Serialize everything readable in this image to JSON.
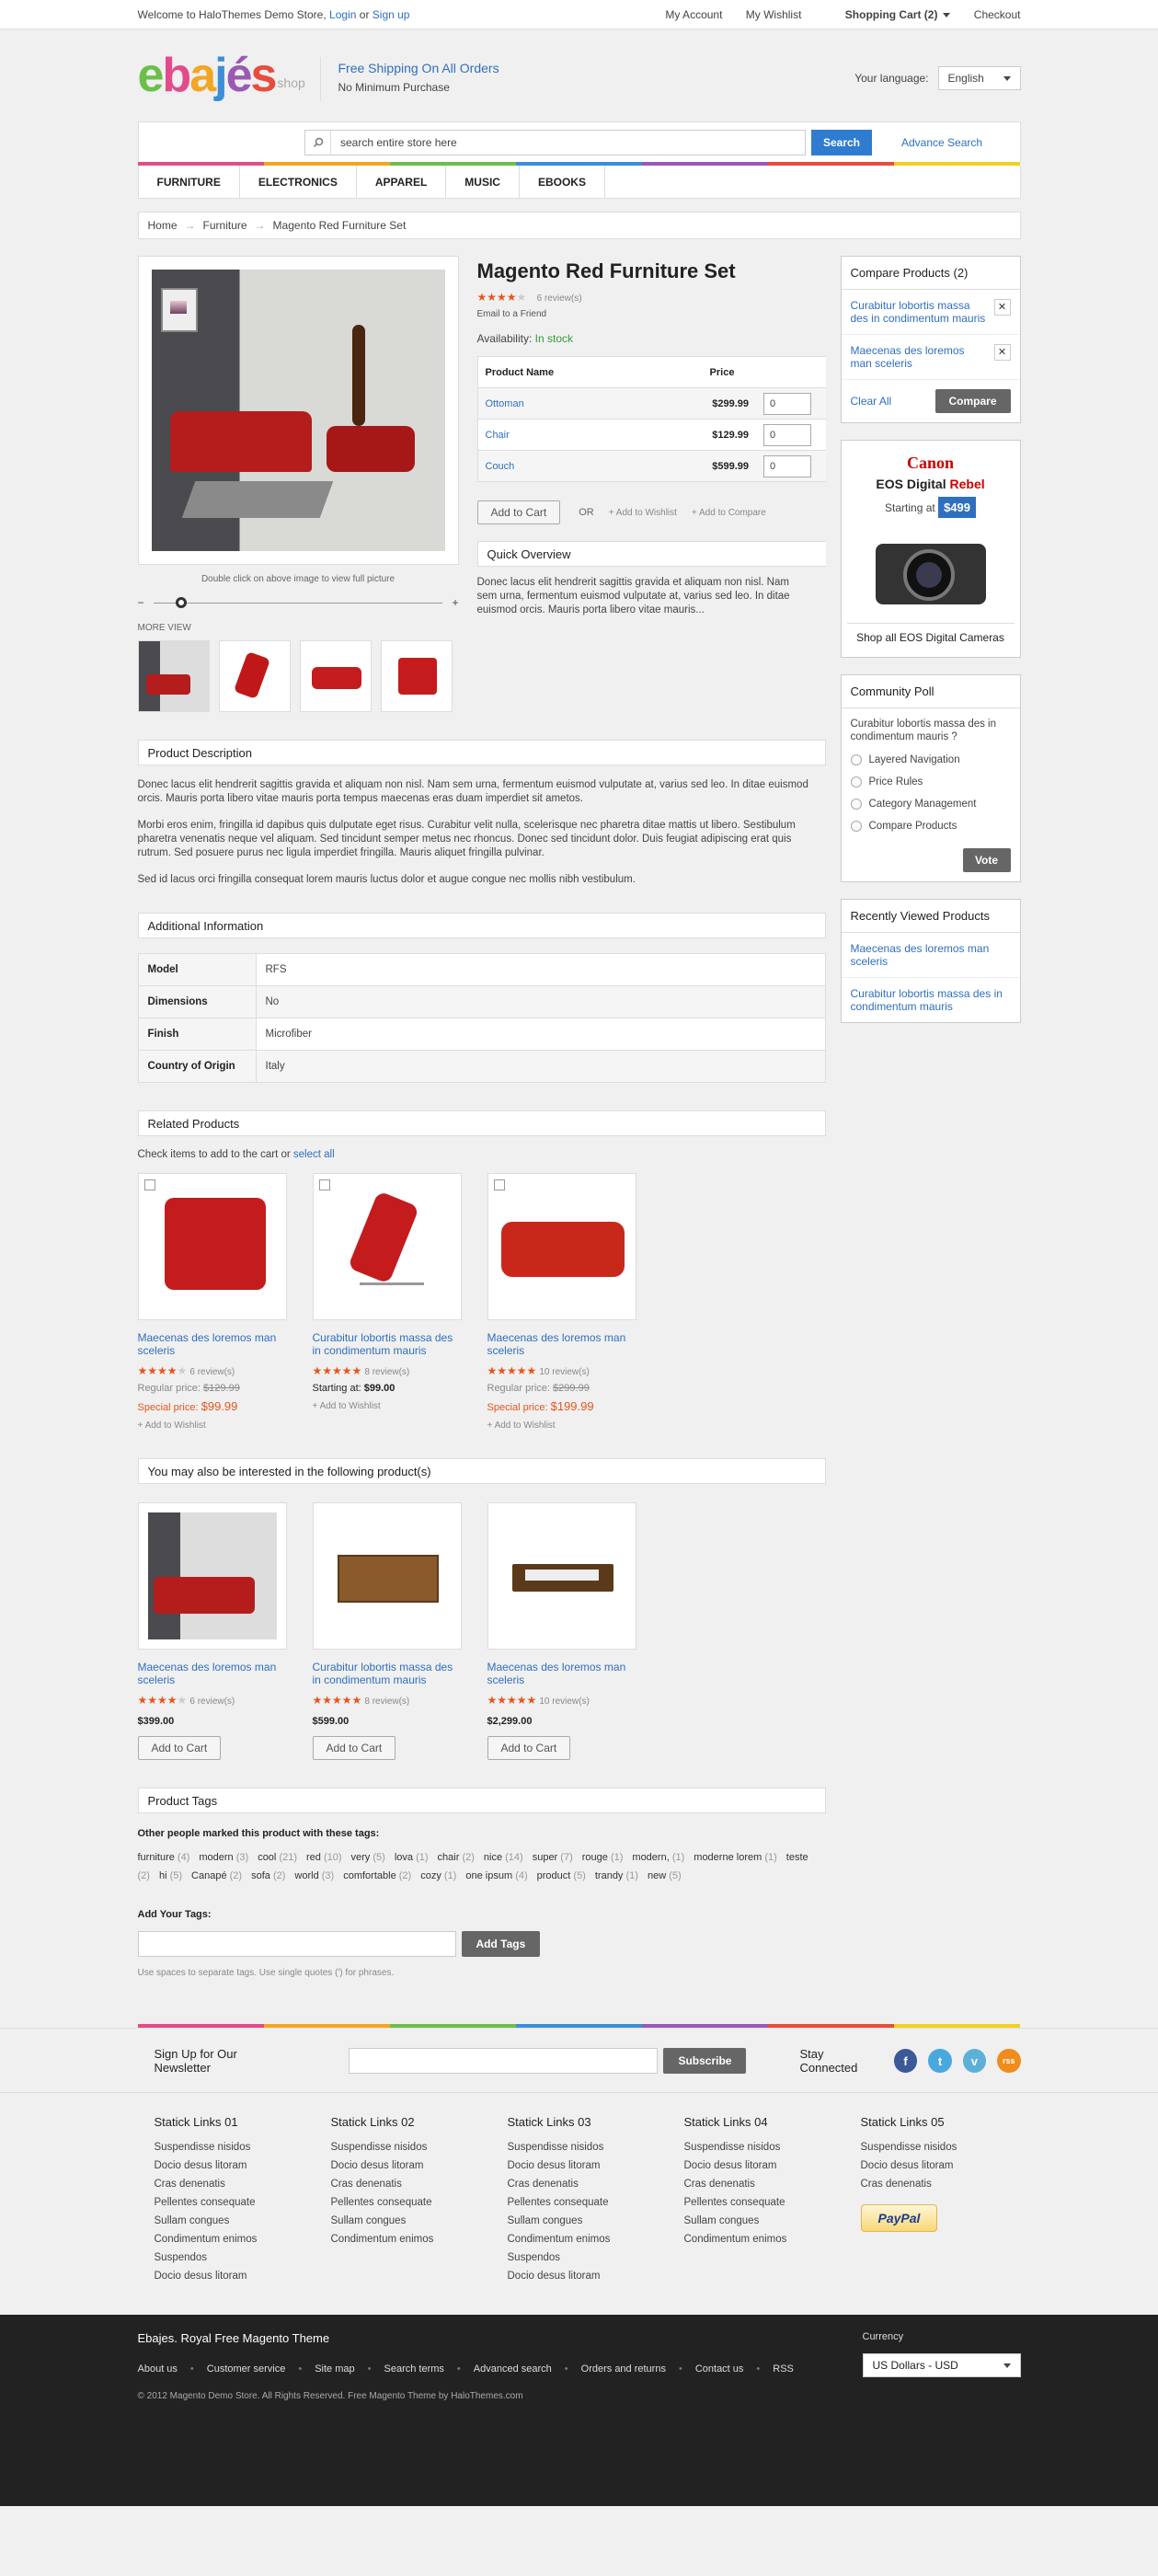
{
  "topbar": {
    "welcome": "Welcome to HaloThemes Demo Store,",
    "login": "Login",
    "or": "or",
    "signup": "Sign up",
    "links": [
      "My Account",
      "My Wishlist",
      "Shopping Cart (2)",
      "Checkout"
    ]
  },
  "header": {
    "logo": [
      "e",
      "b",
      "a",
      "j",
      "é",
      "s"
    ],
    "logo_sub": "shop",
    "shipping_title": "Free Shipping On All Orders",
    "shipping_sub": "No Minimum Purchase",
    "lang_label": "Your language:",
    "lang_value": "English"
  },
  "search": {
    "placeholder": "search entire store here",
    "button": "Search",
    "advanced": "Advance Search"
  },
  "nav": [
    "FURNITURE",
    "ELECTRONICS",
    "APPAREL",
    "MUSIC",
    "EBOOKS"
  ],
  "rainbow_colors": [
    "#e34c8a",
    "#f2a623",
    "#6cbf4a",
    "#3a8fd8",
    "#9b59b6",
    "#e84c3d",
    "#f2d023"
  ],
  "breadcrumb": [
    "Home",
    "Furniture",
    "Magento Red Furniture Set"
  ],
  "product": {
    "name": "Magento Red Furniture Set",
    "reviews": "6 review(s)",
    "email_friend": "Email to a Friend",
    "availability_label": "Availability:",
    "availability": "In stock",
    "image_hint": "Double click on above image to view full picture",
    "more_views": "MORE VIEW",
    "grouped_headers": [
      "Product Name",
      "Price"
    ],
    "grouped": [
      {
        "name": "Ottoman",
        "price": "$299.99",
        "qty": "0"
      },
      {
        "name": "Chair",
        "price": "$129.99",
        "qty": "0"
      },
      {
        "name": "Couch",
        "price": "$599.99",
        "qty": "0"
      }
    ],
    "add_to_cart": "Add to Cart",
    "or": "OR",
    "add_wishlist": "Add to Wishlist",
    "add_compare": "Add to Compare",
    "quick_overview_title": "Quick Overview",
    "quick_overview": "Donec lacus elit hendrerit sagittis gravida et aliquam non nisl. Nam sem urna, fermentum euismod vulputate at, varius sed leo. In ditae euismod orcis. Mauris porta libero vitae mauris..."
  },
  "description": {
    "title": "Product Description",
    "paragraphs": [
      "Donec lacus elit hendrerit sagittis gravida et aliquam non nisl. Nam sem urna, fermentum euismod vulputate at, varius sed leo. In ditae euismod orcis. Mauris porta libero vitae mauris porta tempus maecenas eras duam imperdiet sit ametos.",
      "Morbi eros enim, fringilla id dapibus quis dulputate eget risus. Curabitur velit nulla, scelerisque nec pharetra ditae mattis ut libero. Sestibulum pharetra venenatis neque vel aliquam. Sed tincidunt semper metus nec rhoncus. Donec sed tincidunt dolor. Duis feugiat adipiscing erat quis rutrum. Sed posuere purus nec ligula imperdiet fringilla. Mauris aliquet fringilla pulvinar.",
      "Sed id lacus orci fringilla consequat lorem mauris luctus dolor et augue congue nec mollis nibh vestibulum."
    ]
  },
  "additional": {
    "title": "Additional Information",
    "rows": [
      [
        "Model",
        "RFS"
      ],
      [
        "Dimensions",
        "No"
      ],
      [
        "Finish",
        "Microfiber"
      ],
      [
        "Country of Origin",
        "Italy"
      ]
    ]
  },
  "related": {
    "title": "Related Products",
    "intro": "Check items to add to the cart or",
    "select_all": "select all",
    "items": [
      {
        "name": "Maecenas des loremos man sceleris",
        "reviews": "6 review(s)",
        "regular_label": "Regular price:",
        "regular": "$129.99",
        "special_label": "Special price:",
        "special": "$99.99",
        "wishlist": "Add to Wishlist"
      },
      {
        "name": "Curabitur lobortis massa des in condimentum mauris",
        "reviews": "8 review(s)",
        "starting_label": "Starting at:",
        "starting": "$99.00",
        "wishlist": "Add to Wishlist"
      },
      {
        "name": "Maecenas des loremos man sceleris",
        "reviews": "10 review(s)",
        "regular_label": "Regular price:",
        "regular": "$299.99",
        "special_label": "Special price:",
        "special": "$199.99",
        "wishlist": "Add to Wishlist"
      }
    ]
  },
  "upsell": {
    "title": "You may also be interested in the following product(s)",
    "items": [
      {
        "name": "Maecenas des loremos man sceleris",
        "reviews": "6 review(s)",
        "price": "$399.00",
        "button": "Add to Cart"
      },
      {
        "name": "Curabitur lobortis massa des in condimentum mauris",
        "reviews": "8 review(s)",
        "price": "$599.00",
        "button": "Add to Cart"
      },
      {
        "name": "Maecenas des loremos man sceleris",
        "reviews": "10 review(s)",
        "price": "$2,299.00",
        "button": "Add to Cart"
      }
    ]
  },
  "tags": {
    "title": "Product Tags",
    "others": "Other people marked this product with these tags:",
    "list": [
      [
        "furniture",
        "(4)"
      ],
      [
        "modern",
        "(3)"
      ],
      [
        "cool",
        "(21)"
      ],
      [
        "red",
        "(10)"
      ],
      [
        "very",
        "(5)"
      ],
      [
        "lova",
        "(1)"
      ],
      [
        "chair",
        "(2)"
      ],
      [
        "nice",
        "(14)"
      ],
      [
        "super",
        "(7)"
      ],
      [
        "rouge",
        "(1)"
      ],
      [
        "modern,",
        "(1)"
      ],
      [
        "moderne lorem",
        "(1)"
      ],
      [
        "teste",
        "(2)"
      ],
      [
        "hi",
        "(5)"
      ],
      [
        "Canapé",
        "(2)"
      ],
      [
        "sofa",
        "(2)"
      ],
      [
        "world",
        "(3)"
      ],
      [
        "comfortable",
        "(2)"
      ],
      [
        "cozy",
        "(1)"
      ],
      [
        "one ipsum",
        "(4)"
      ],
      [
        "product",
        "(5)"
      ],
      [
        "trandy",
        "(1)"
      ],
      [
        "new",
        "(5)"
      ]
    ],
    "add_title": "Add Your Tags:",
    "add_button": "Add Tags",
    "hint": "Use spaces to separate tags. Use single quotes (') for phrases."
  },
  "sidebar": {
    "compare_title": "Compare Products (2)",
    "compare_items": [
      "Curabitur lobortis massa des in condimentum mauris",
      "Maecenas des loremos man sceleris"
    ],
    "clear_all": "Clear All",
    "compare_button": "Compare",
    "ad_brand": "Canon",
    "ad_model_a": "EOS Digital",
    "ad_model_b": "Rebel",
    "ad_starting": "Starting at",
    "ad_price": "$499",
    "ad_link": "Shop all EOS Digital Cameras",
    "poll_title": "Community Poll",
    "poll_question": "Curabitur lobortis massa des in condimentum mauris ?",
    "poll_options": [
      "Layered Navigation",
      "Price Rules",
      "Category Management",
      "Compare Products"
    ],
    "vote": "Vote",
    "recent_title": "Recently Viewed Products",
    "recent_items": [
      "Maecenas des loremos man sceleris",
      "Curabitur lobortis massa des in condimentum mauris"
    ]
  },
  "newsletter": {
    "label": "Sign Up for Our Newsletter",
    "button": "Subscribe",
    "stay": "Stay Connected",
    "social": [
      "f",
      "t",
      "v",
      "rss"
    ]
  },
  "footer_links": [
    {
      "title": "Statick Links 01",
      "items": [
        "Suspendisse nisidos",
        "Docio desus litoram",
        "Cras denenatis",
        "Pellentes consequate",
        "Sullam congues",
        "Condimentum enimos",
        "Suspendos",
        "Docio desus litoram"
      ]
    },
    {
      "title": "Statick Links 02",
      "items": [
        "Suspendisse nisidos",
        "Docio desus litoram",
        "Cras denenatis",
        "Pellentes consequate",
        "Sullam congues",
        "Condimentum enimos"
      ]
    },
    {
      "title": "Statick Links 03",
      "items": [
        "Suspendisse nisidos",
        "Docio desus litoram",
        "Cras denenatis",
        "Pellentes consequate",
        "Sullam congues",
        "Condimentum enimos",
        "Suspendos",
        "Docio desus litoram"
      ]
    },
    {
      "title": "Statick Links 04",
      "items": [
        "Suspendisse nisidos",
        "Docio desus litoram",
        "Cras denenatis",
        "Pellentes consequate",
        "Sullam congues",
        "Condimentum enimos"
      ]
    },
    {
      "title": "Statick Links 05",
      "items": [
        "Suspendisse nisidos",
        "Docio desus litoram",
        "Cras denenatis"
      ],
      "badge": "PayPal"
    }
  ],
  "footer": {
    "title": "Ebajes. Royal Free Magento Theme",
    "nav": [
      "About us",
      "Customer service",
      "Site map",
      "Search terms",
      "Advanced search",
      "Orders and returns",
      "Contact us",
      "RSS"
    ],
    "copyright": "© 2012 Magento Demo Store. All Rights Reserved. Free Magento Theme by HaloThemes.com",
    "currency_label": "Currency",
    "currency_value": "US Dollars - USD"
  }
}
